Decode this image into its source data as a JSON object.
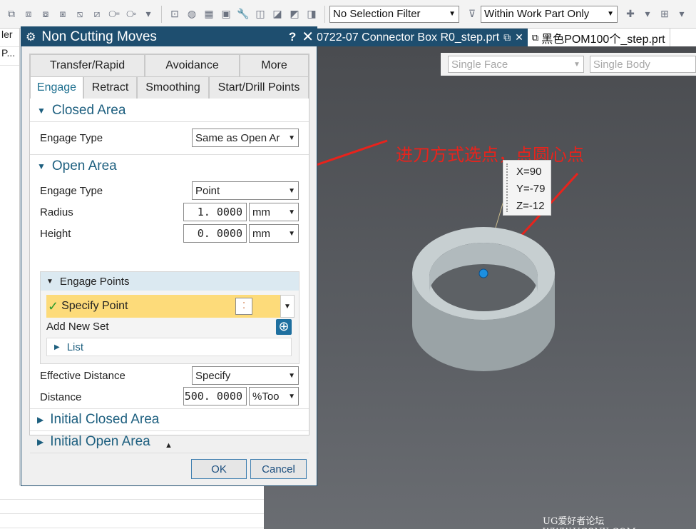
{
  "toolbar": {
    "selection_filter": "No Selection Filter",
    "scope_filter": "Within Work Part Only"
  },
  "left_strip": {
    "row1": "ler",
    "row2": "P..."
  },
  "doc_tabs": {
    "active_label": "0722-07 Connector Box R0_step.prt",
    "inactive_label": "黑色POM100个_step.prt"
  },
  "viewport": {
    "face_rule": "Single Face",
    "body_rule": "Single Body",
    "annotation": "进刀方式选点，点圆心点",
    "coords": {
      "x": "X=90",
      "y": "Y=-79",
      "z": "Z=-12"
    },
    "watermark": "UG爱好者论坛 WWW.UGSNX.COM"
  },
  "dialog": {
    "title": "Non Cutting Moves",
    "help": "?",
    "tabs_row1": [
      "Transfer/Rapid",
      "Avoidance",
      "More"
    ],
    "tabs_row2": [
      "Engage",
      "Retract",
      "Smoothing",
      "Start/Drill Points"
    ],
    "closed_area": {
      "header": "Closed Area",
      "engage_type_label": "Engage Type",
      "engage_type_value": "Same as Open Ar"
    },
    "open_area": {
      "header": "Open Area",
      "engage_type_label": "Engage Type",
      "engage_type_value": "Point",
      "radius_label": "Radius",
      "radius_value": "1. 0000",
      "radius_unit": "mm",
      "height_label": "Height",
      "height_value": "0. 0000",
      "height_unit": "mm"
    },
    "engage_points": {
      "header": "Engage Points",
      "specify_point": "Specify Point",
      "add_new_set": "Add New Set",
      "list": "List"
    },
    "effective_distance_label": "Effective Distance",
    "effective_distance_value": "Specify",
    "distance_label": "Distance",
    "distance_value": "500. 0000",
    "distance_unit": "%Too",
    "initial_closed_area": "Initial Closed Area",
    "initial_open_area": "Initial Open Area",
    "ok": "OK",
    "cancel": "Cancel"
  },
  "colors": {
    "title_bar": "#1e4e6f",
    "section_text": "#1d5f7f",
    "highlight": "#fddb7a",
    "annotation": "#e8231c"
  }
}
